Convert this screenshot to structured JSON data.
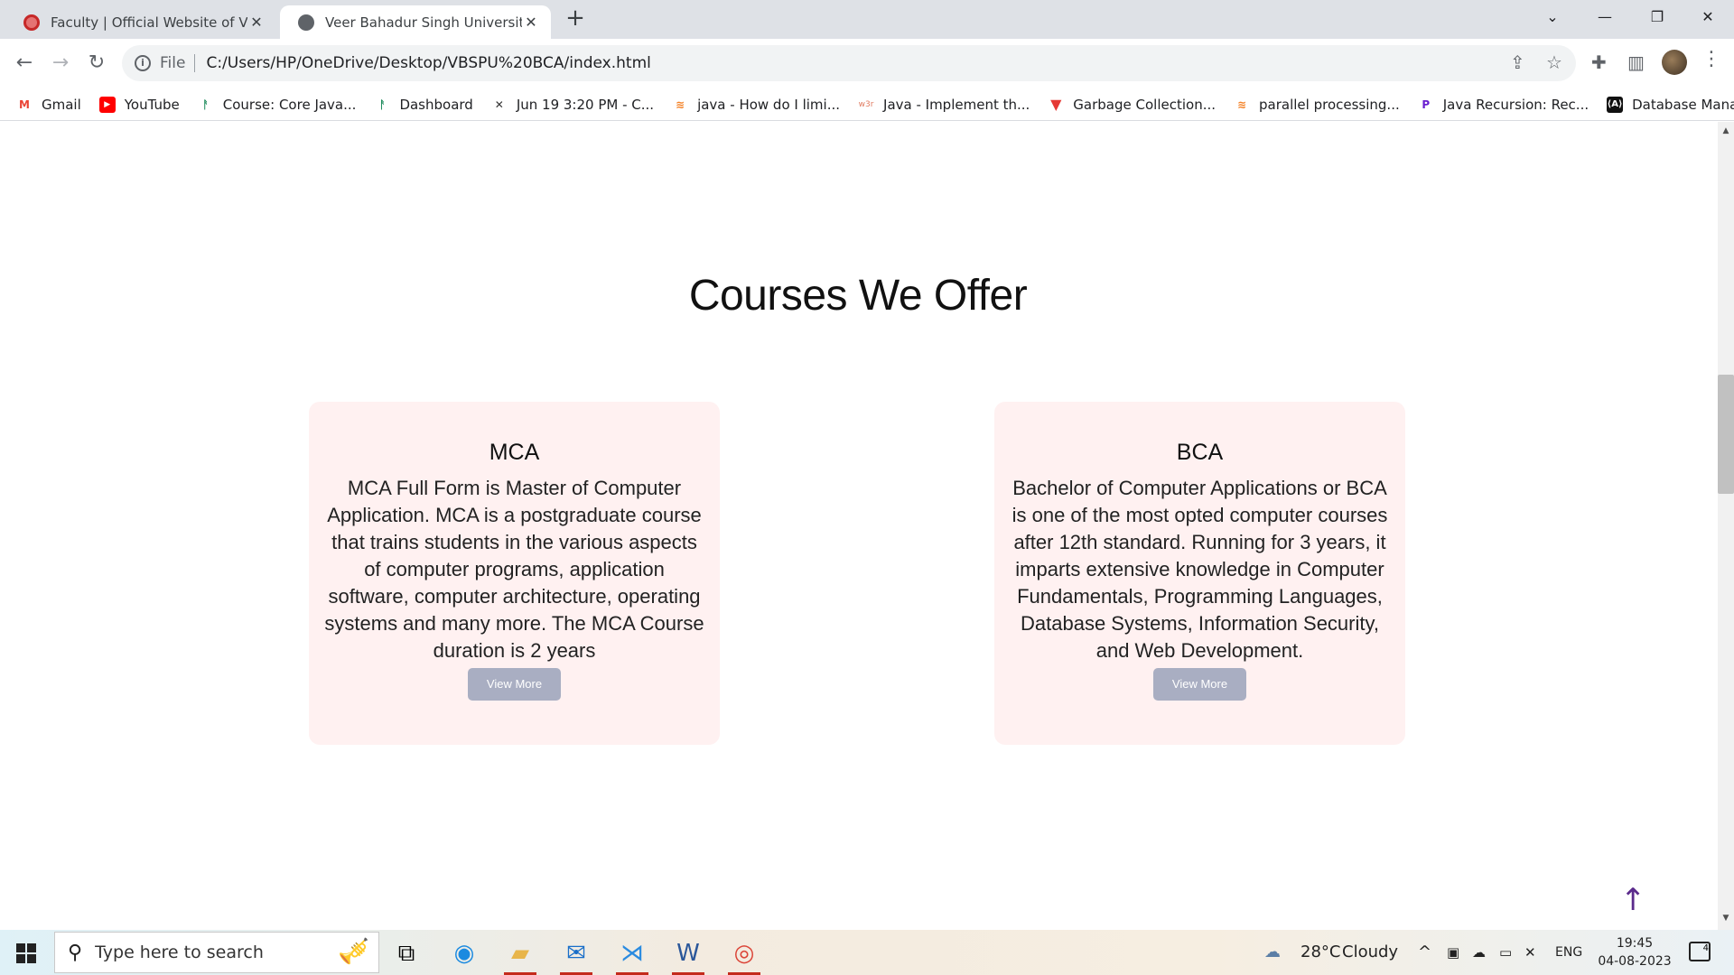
{
  "browser": {
    "tabs": [
      {
        "title": "Faculty | Official Website of Veer Bahadur Singh",
        "active": false
      },
      {
        "title": "Veer Bahadur Singh University,Jaunpur",
        "active": true
      }
    ],
    "address": {
      "scheme_label": "File",
      "url": "C:/Users/HP/OneDrive/Desktop/VBSPU%20BCA/index.html"
    },
    "bookmarks": [
      {
        "label": "Gmail",
        "icon": "gmail-icon"
      },
      {
        "label": "YouTube",
        "icon": "youtube-icon"
      },
      {
        "label": "Course: Core Java...",
        "icon": "course-icon"
      },
      {
        "label": "Dashboard",
        "icon": "dashboard-icon"
      },
      {
        "label": "Jun 19 3:20 PM - C...",
        "icon": "calendar-icon"
      },
      {
        "label": "java - How do I limi...",
        "icon": "stackoverflow-icon"
      },
      {
        "label": "Java - Implement th...",
        "icon": "w3r-icon"
      },
      {
        "label": "Garbage Collection...",
        "icon": "garbage-icon"
      },
      {
        "label": "parallel processing...",
        "icon": "stackoverflow-icon"
      },
      {
        "label": "Java Recursion: Rec...",
        "icon": "p-icon"
      },
      {
        "label": "Database Manage...",
        "icon": "db-icon"
      }
    ]
  },
  "page": {
    "section_title": "Courses We Offer",
    "courses": [
      {
        "name": "MCA",
        "description": "MCA Full Form is Master of Computer Application. MCA is a postgraduate course that trains students in the various aspects of computer programs, application software, computer architecture, operating systems and many more. The MCA Course duration is 2 years",
        "button": "View More"
      },
      {
        "name": "BCA",
        "description": "Bachelor of Computer Applications or BCA is one of the most opted computer courses after 12th standard. Running for 3 years, it imparts extensive knowledge in Computer Fundamentals, Programming Languages, Database Systems, Information Security, and Web Development.",
        "button": "View More"
      }
    ]
  },
  "taskbar": {
    "search_placeholder": "Type here to search",
    "weather": {
      "temp": "28°C",
      "condition": "Cloudy"
    },
    "language": "ENG",
    "time": "19:45",
    "date": "04-08-2023",
    "notifications": "4"
  },
  "colors": {
    "card_bg": "#fff1f1",
    "button_bg": "#a9aec2",
    "to_top_arrow": "#5b2b8c"
  }
}
